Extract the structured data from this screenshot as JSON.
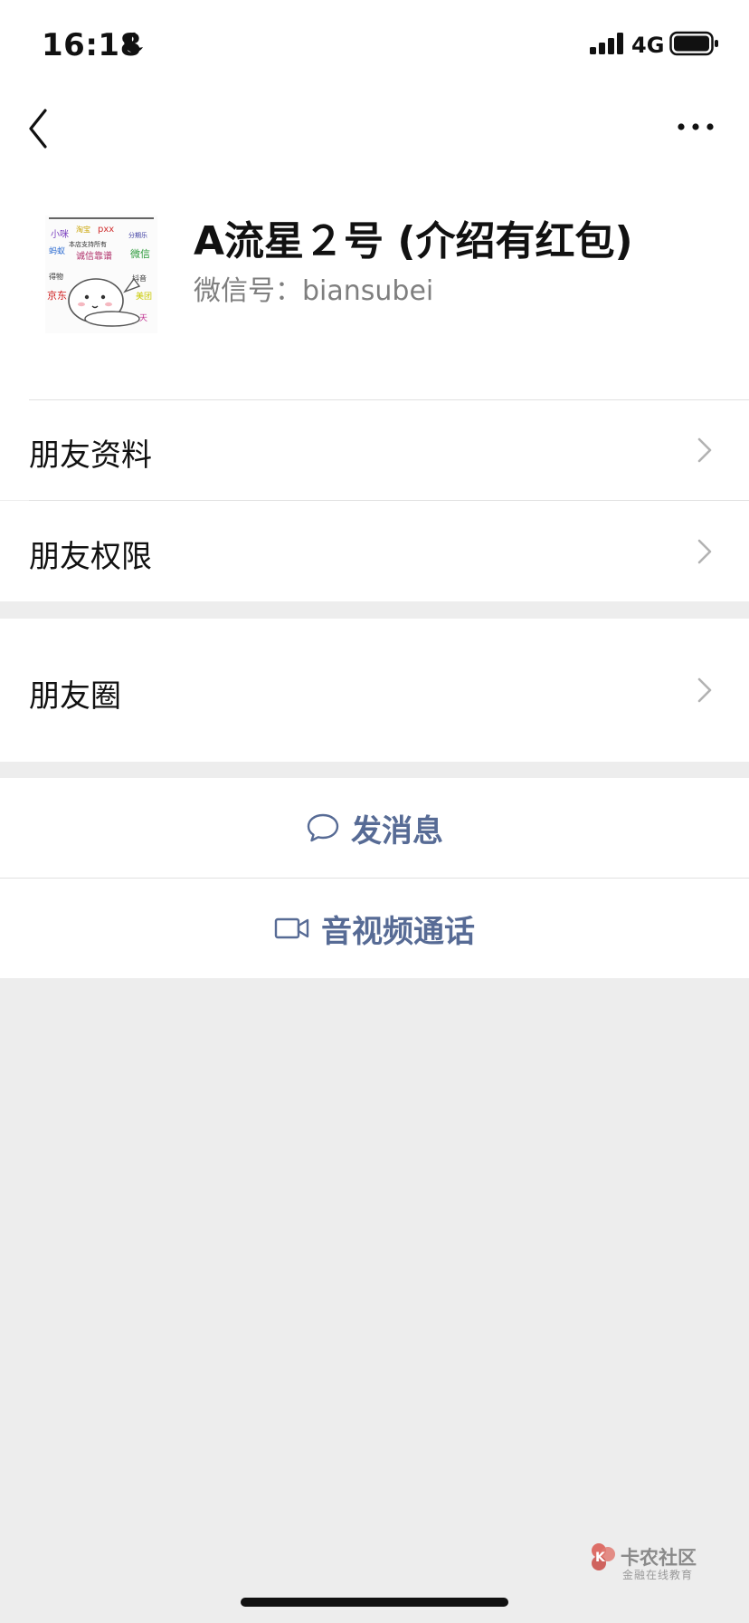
{
  "status_bar": {
    "time": "16:18",
    "network": "4G"
  },
  "profile": {
    "name": "A流星２号 (介绍有红包)",
    "wechat_id": "微信号：biansubei",
    "avatar_text": [
      "小咪",
      "淘宝",
      "pxx",
      "分期乐",
      "蚂蚁",
      "本店支持所有",
      "诚信靠谱",
      "微信",
      "得物",
      "抖音",
      "京东",
      "美团",
      "天"
    ]
  },
  "menu": [
    {
      "label": "朋友资料"
    },
    {
      "label": "朋友权限"
    },
    {
      "label": "朋友圈"
    }
  ],
  "actions": {
    "message": "发消息",
    "call": "音视频通话"
  },
  "watermark": {
    "title": "卡农社区",
    "subtitle": "金融在线教育"
  },
  "colors": {
    "link": "#576b95",
    "background": "#ededed",
    "cell": "#ffffff"
  }
}
